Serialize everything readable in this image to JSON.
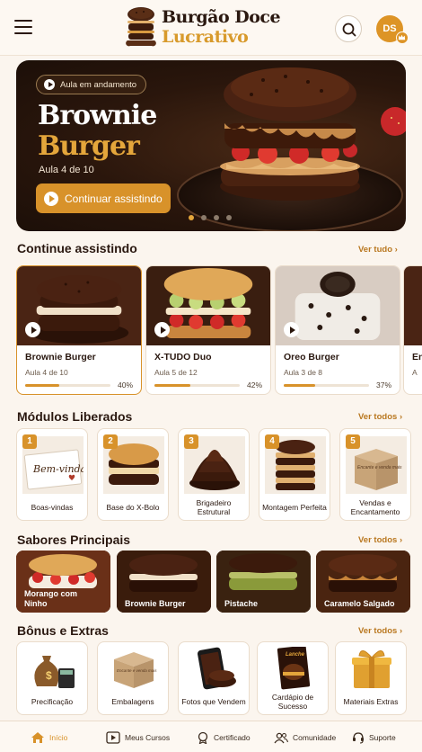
{
  "header": {
    "brand_line1": "Burgão Doce",
    "brand_line2": "Lucrativo",
    "avatar_initials": "DS"
  },
  "hero": {
    "badge": "Aula em andamento",
    "title_line1": "Brownie",
    "title_line2": "Burger",
    "lesson": "Aula 4 de 10",
    "cta": "Continuar assistindo",
    "slides": 4,
    "active_slide": 0
  },
  "continue": {
    "title": "Continue assistindo",
    "link": "Ver tudo",
    "items": [
      {
        "title": "Brownie Burger",
        "lesson": "Aula 4 de 10",
        "progress": 40,
        "progress_label": "40%"
      },
      {
        "title": "X-TUDO Duo",
        "lesson": "Aula 5 de 12",
        "progress": 42,
        "progress_label": "42%"
      },
      {
        "title": "Oreo Burger",
        "lesson": "Aula 3 de 8",
        "progress": 37,
        "progress_label": "37%"
      },
      {
        "title": "En",
        "lesson": "A",
        "progress": 30,
        "progress_label": ""
      }
    ]
  },
  "modules": {
    "title": "Módulos Liberados",
    "link": "Ver todos",
    "items": [
      {
        "num": "1",
        "label": "Boas-vindas",
        "card_text": "Bem-vinda"
      },
      {
        "num": "2",
        "label": "Base do X-Bolo"
      },
      {
        "num": "3",
        "label": "Brigadeiro Estrutural"
      },
      {
        "num": "4",
        "label": "Montagem Perfeita"
      },
      {
        "num": "5",
        "label": "Vendas e Encantamento",
        "box_text": "Encante e venda mais"
      }
    ]
  },
  "flavors": {
    "title": "Sabores Principais",
    "link": "Ver todos",
    "items": [
      {
        "label": "Morango com Ninho"
      },
      {
        "label": "Brownie Burger"
      },
      {
        "label": "Pistache"
      },
      {
        "label": "Caramelo Salgado"
      }
    ]
  },
  "bonus": {
    "title": "Bônus e Extras",
    "link": "Ver todos",
    "items": [
      {
        "label": "Precificação"
      },
      {
        "label": "Embalagens",
        "box_text": "Encante e venda mais"
      },
      {
        "label": "Fotos que Vendem"
      },
      {
        "label": "Cardápio de Sucesso",
        "menu_brand": "Lanche"
      },
      {
        "label": "Materiais Extras"
      }
    ]
  },
  "nav": {
    "items": [
      {
        "label": "Início",
        "icon": "home-icon",
        "active": true
      },
      {
        "label": "Meus Cursos",
        "icon": "play-icon",
        "active": false
      },
      {
        "label": "Certificado",
        "icon": "certificate-icon",
        "active": false
      },
      {
        "label": "Comunidade",
        "icon": "community-icon",
        "active": false
      },
      {
        "label": "Suporte",
        "icon": "support-icon",
        "active": false
      }
    ]
  },
  "colors": {
    "accent": "#d8922a",
    "brand_dark": "#2a1810",
    "background": "#fbf5ee"
  }
}
